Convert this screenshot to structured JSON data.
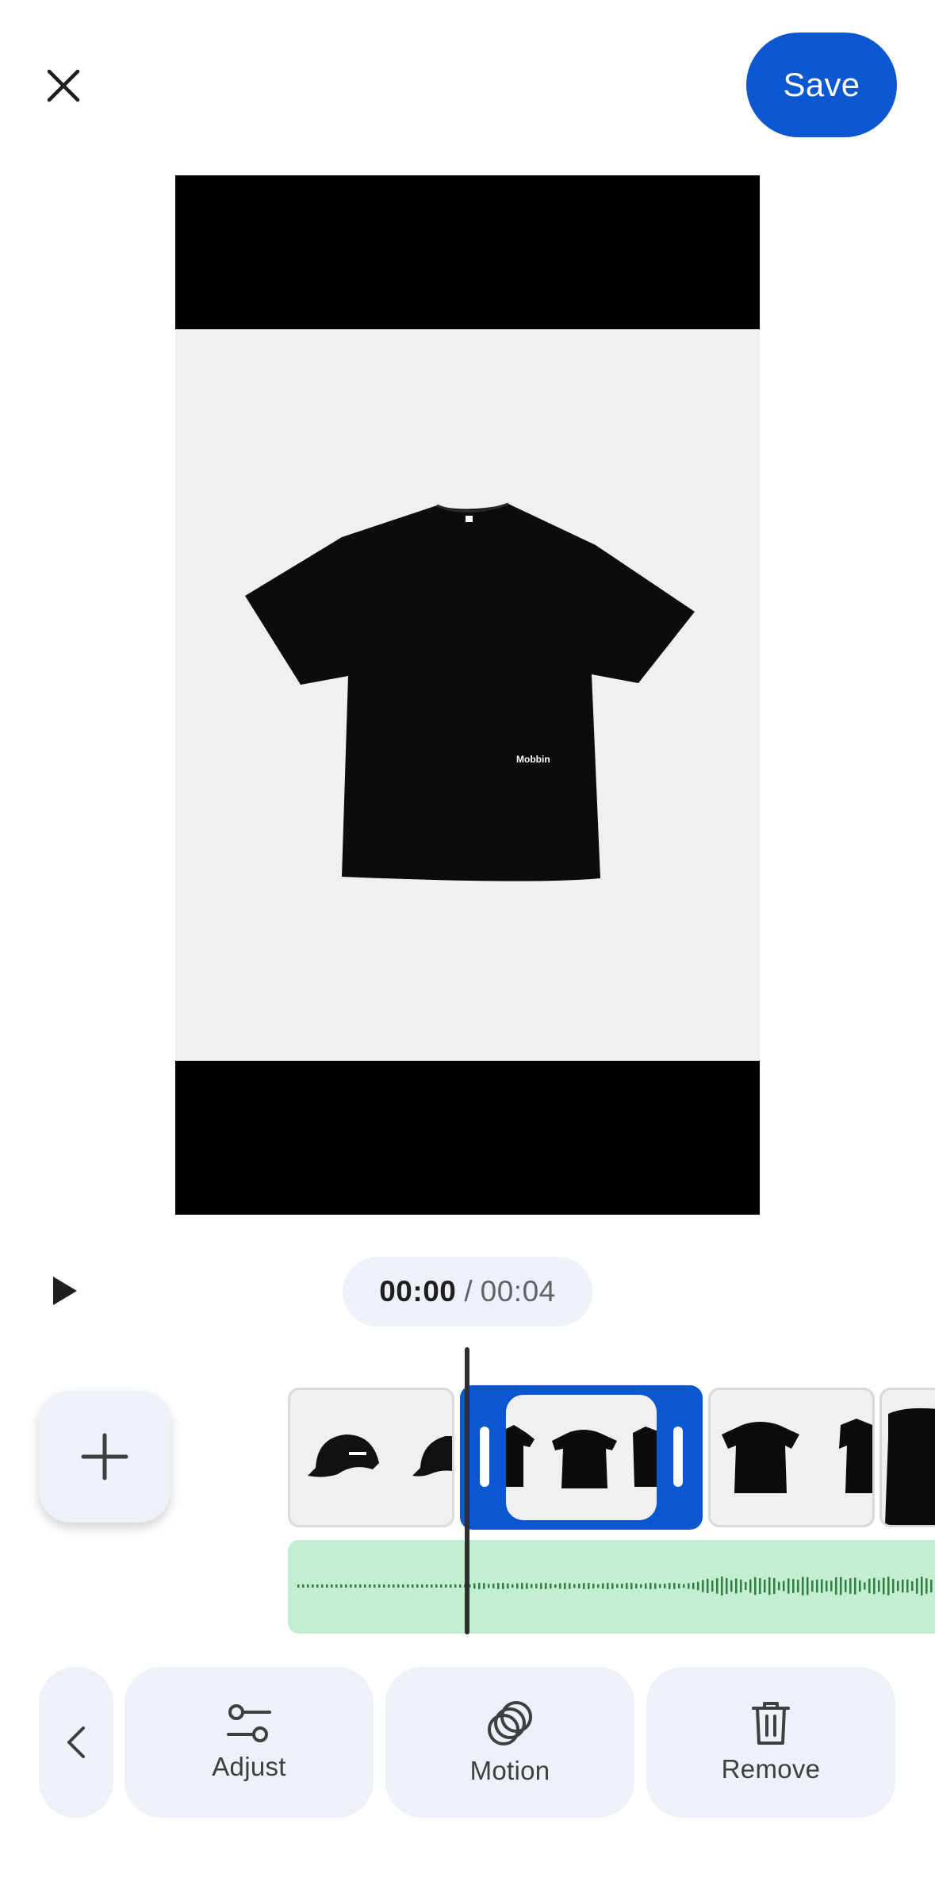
{
  "topbar": {
    "close_icon": "close-icon",
    "save_label": "Save"
  },
  "preview": {
    "brand_text": "Mobbin"
  },
  "playback": {
    "play_icon": "play-icon",
    "current_time": "00:00",
    "separator": "/",
    "total_time": "00:04"
  },
  "timeline": {
    "add_icon": "plus-icon",
    "clips": [
      "cap",
      "t-shirt",
      "t-shirt",
      "t-shirt"
    ],
    "selected_clip": 1
  },
  "toolbar": {
    "back_icon": "chevron-left-icon",
    "tools": [
      {
        "label": "Adjust",
        "icon": "sliders-icon"
      },
      {
        "label": "Motion",
        "icon": "motion-icon"
      },
      {
        "label": "Remove",
        "icon": "trash-icon"
      }
    ]
  },
  "colors": {
    "accent": "#0b57d0",
    "surface": "#eef1f7",
    "audio_track": "#c4eed0",
    "waveform": "#2f7d45"
  }
}
